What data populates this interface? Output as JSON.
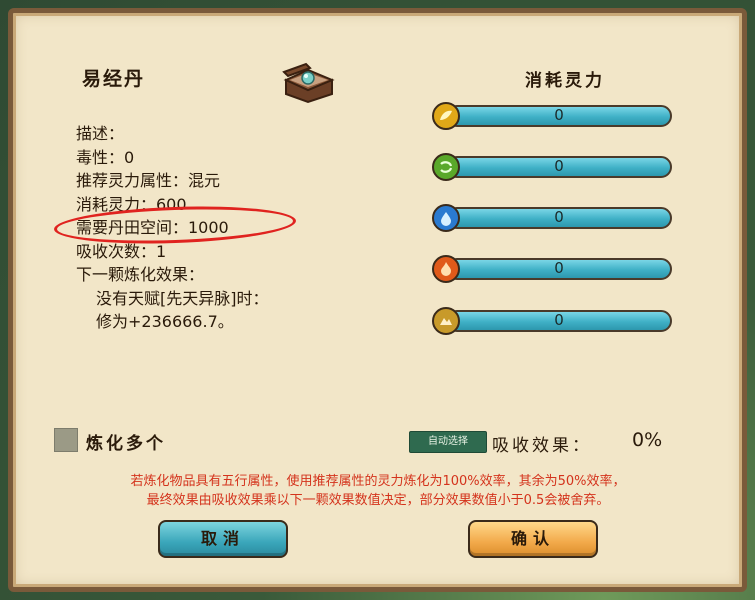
{
  "item": {
    "name": "易经丹"
  },
  "consume": {
    "title": "消耗灵力",
    "elements": [
      {
        "icon": "metal-element-icon",
        "color": "#e0a818",
        "value": "0"
      },
      {
        "icon": "wood-element-icon",
        "color": "#5aa82a",
        "value": "0"
      },
      {
        "icon": "water-element-icon",
        "color": "#2a7ad0",
        "value": "0"
      },
      {
        "icon": "fire-element-icon",
        "color": "#e05a1a",
        "value": "0"
      },
      {
        "icon": "earth-element-icon",
        "color": "#c89a2a",
        "value": "0"
      }
    ]
  },
  "info": {
    "description": "描述：",
    "toxicity": "毒性：0",
    "recommended_attr": "推荐灵力属性：混元",
    "consume_power": "消耗灵力：600",
    "dantian_space": "需要丹田空间：1000",
    "absorb_count": "吸收次数：1",
    "next_effect_title": "下一颗炼化效果：",
    "condition": "没有天赋[先天异脉]时：",
    "cultivation": "修为+236666.7。"
  },
  "controls": {
    "refine_multiple": "炼化多个",
    "auto_select": "自动选择",
    "absorb_label": "吸收效果：",
    "absorb_value": "0%"
  },
  "note": {
    "line1": "若炼化物品具有五行属性，使用推荐属性的灵力炼化为100%效率，其余为50%效率，",
    "line2": "最终效果由吸收效果乘以下一颗效果数值决定，部分效果数值小于0.5会被舍弃。"
  },
  "buttons": {
    "cancel": "取消",
    "confirm": "确认"
  },
  "colors": {
    "panel": "#f2e6c8",
    "border": "#7a5a3a",
    "bar": "#3fb0c6",
    "note_text": "#d4331c",
    "annotation_oval": "#e0231f",
    "cancel_button": "#3aa6ba",
    "confirm_button": "#f2a94a"
  }
}
